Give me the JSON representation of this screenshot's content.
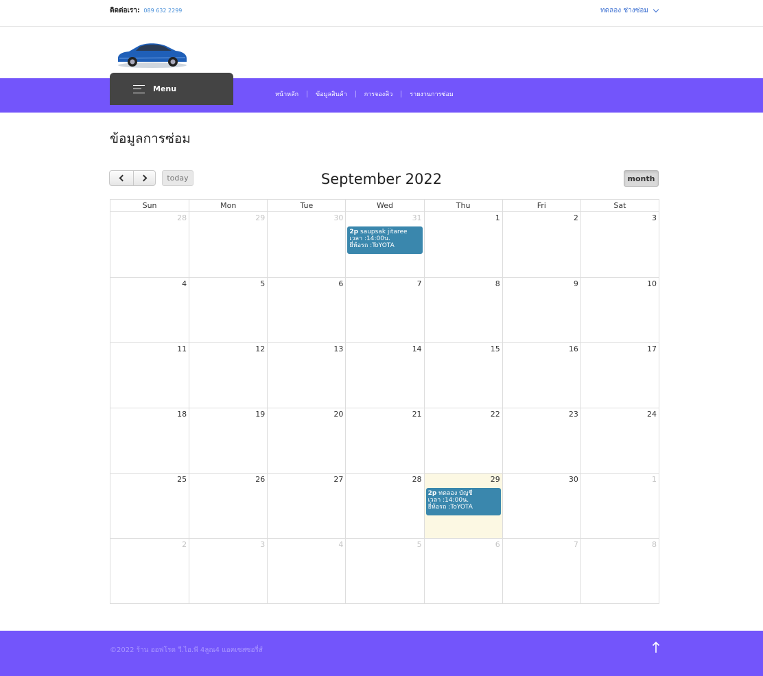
{
  "topbar": {
    "contact_label": "ติดต่อเรา:",
    "contact_phone": "089 632 2299",
    "user_name": "ทดลอง ช่างซ่อม"
  },
  "nav": {
    "menu_label": "Menu",
    "links": [
      "หน้าหลัก",
      "ข้อมูลสินค้า",
      "การจองคิว",
      "รายงานการซ่อม"
    ]
  },
  "page": {
    "title": "ข้อมูลการซ่อม"
  },
  "calendar": {
    "today_label": "today",
    "title": "September 2022",
    "view_label": "month",
    "day_headers": [
      "Sun",
      "Mon",
      "Tue",
      "Wed",
      "Thu",
      "Fri",
      "Sat"
    ],
    "days": [
      "28",
      "29",
      "30",
      "31",
      "1",
      "2",
      "3",
      "4",
      "5",
      "6",
      "7",
      "8",
      "9",
      "10",
      "11",
      "12",
      "13",
      "14",
      "15",
      "16",
      "17",
      "18",
      "19",
      "20",
      "21",
      "22",
      "23",
      "24",
      "25",
      "26",
      "27",
      "28",
      "29",
      "30",
      "1",
      "2",
      "3",
      "4",
      "5",
      "6",
      "7",
      "8"
    ],
    "events": [
      {
        "time": "2p",
        "name": "saupsak jitaree",
        "line2": "เวลา :14:00น.",
        "line3": "ยี่ห้อรถ :ToYOTA"
      },
      {
        "time": "2p",
        "name": "ทดลอง บัญชี",
        "line2": "เวลา :14:00น.",
        "line3": "ยี่ห้อรถ :ToYOTA"
      }
    ]
  },
  "footer": {
    "text": "©2022 ร้าน ออฟโรด วี.ไอ.พี 4ลูณ4 แอคเซสซอรี่ส์"
  },
  "colors": {
    "primary": "#7355fb",
    "event": "#3a87ad",
    "today_bg": "#fcf8e3",
    "menu_bg": "#444444"
  }
}
